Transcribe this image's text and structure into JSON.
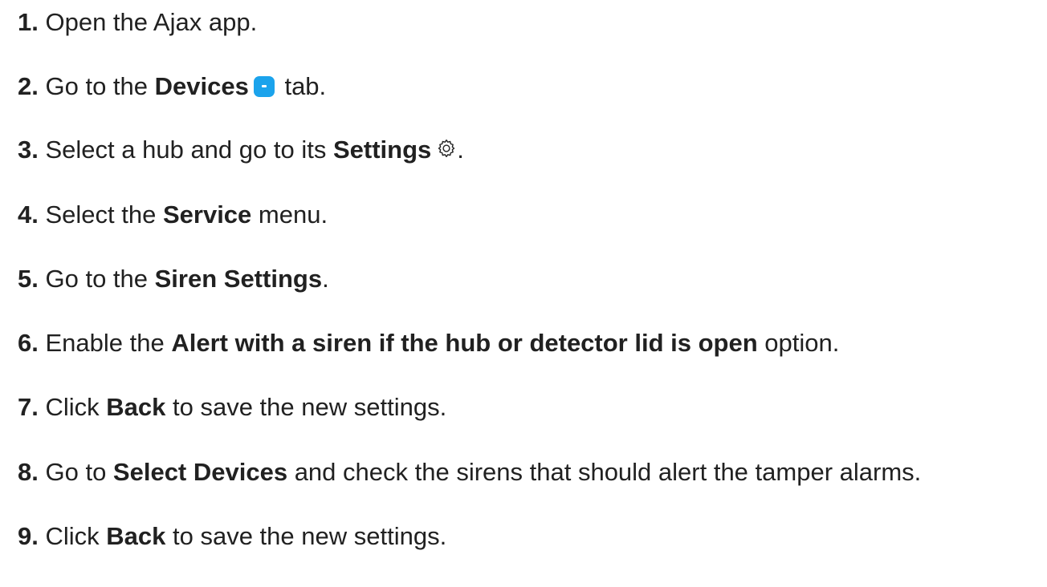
{
  "steps": [
    {
      "number": "1.",
      "text": "Open the Ajax app."
    },
    {
      "number": "2.",
      "pre": "Go to the ",
      "bold": "Devices",
      "icon": "devices-tab-icon",
      "post": " tab."
    },
    {
      "number": "3.",
      "pre": "Select a hub and go to its ",
      "bold": "Settings",
      "icon": "gear-icon",
      "post": "."
    },
    {
      "number": "4.",
      "pre": "Select the ",
      "bold": "Service",
      "post": " menu."
    },
    {
      "number": "5.",
      "pre": "Go to the ",
      "bold": "Siren Settings",
      "post": "."
    },
    {
      "number": "6.",
      "pre": "Enable the ",
      "bold": "Alert with a siren if the hub or detector lid is open",
      "post": " option."
    },
    {
      "number": "7.",
      "pre": "Click ",
      "bold": "Back",
      "post": " to save the new settings."
    },
    {
      "number": "8.",
      "pre": "Go to ",
      "bold": "Select Devices",
      "post": " and check the sirens that should alert the tamper alarms."
    },
    {
      "number": "9.",
      "pre": "Click ",
      "bold": "Back",
      "post": " to save the new settings."
    }
  ],
  "colors": {
    "text": "#212121",
    "devices_icon": "#1ba3ec"
  }
}
